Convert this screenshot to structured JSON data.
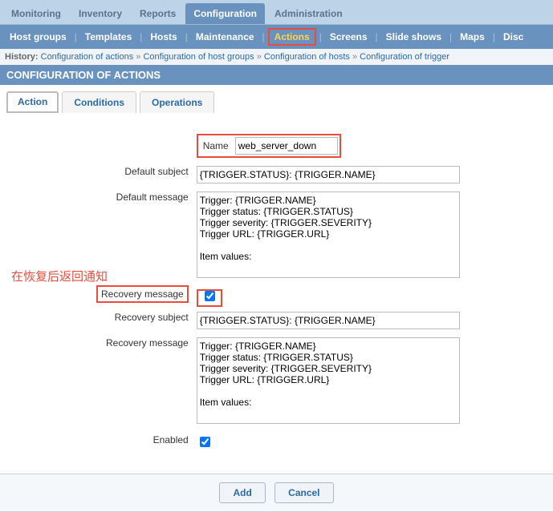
{
  "topnav": {
    "items": [
      {
        "label": "Monitoring"
      },
      {
        "label": "Inventory"
      },
      {
        "label": "Reports"
      },
      {
        "label": "Configuration"
      },
      {
        "label": "Administration"
      }
    ],
    "active_index": 3
  },
  "subnav": {
    "items": [
      {
        "label": "Host groups",
        "hilite": false
      },
      {
        "label": "Templates",
        "hilite": false
      },
      {
        "label": "Hosts",
        "hilite": false
      },
      {
        "label": "Maintenance",
        "hilite": false
      },
      {
        "label": "Actions",
        "hilite": true
      },
      {
        "label": "Screens",
        "hilite": false
      },
      {
        "label": "Slide shows",
        "hilite": false
      },
      {
        "label": "Maps",
        "hilite": false
      },
      {
        "label": "Disc",
        "hilite": false
      }
    ]
  },
  "history": {
    "prefix": "History:",
    "crumbs": [
      "Configuration of actions",
      "Configuration of host groups",
      "Configuration of hosts",
      "Configuration of trigger"
    ]
  },
  "header": "CONFIGURATION OF ACTIONS",
  "tabs": {
    "items": [
      {
        "label": "Action",
        "active": true
      },
      {
        "label": "Conditions",
        "active": false
      },
      {
        "label": "Operations",
        "active": false
      }
    ]
  },
  "form": {
    "name_label": "Name",
    "name_value": "web_server_down",
    "default_subject_label": "Default subject",
    "default_subject_value": "{TRIGGER.STATUS}: {TRIGGER.NAME}",
    "default_message_label": "Default message",
    "default_message_value": "Trigger: {TRIGGER.NAME}\nTrigger status: {TRIGGER.STATUS}\nTrigger severity: {TRIGGER.SEVERITY}\nTrigger URL: {TRIGGER.URL}\n\nItem values:\n",
    "recovery_annotation": "在恢复后返回通知",
    "recovery_message_label": "Recovery message",
    "recovery_message_checked": true,
    "recovery_subject_label": "Recovery subject",
    "recovery_subject_value": "{TRIGGER.STATUS}: {TRIGGER.NAME}",
    "recovery_body_label": "Recovery message",
    "recovery_body_value": "Trigger: {TRIGGER.NAME}\nTrigger status: {TRIGGER.STATUS}\nTrigger severity: {TRIGGER.SEVERITY}\nTrigger URL: {TRIGGER.URL}\n\nItem values:\n",
    "enabled_label": "Enabled",
    "enabled_checked": true
  },
  "footer": {
    "add": "Add",
    "cancel": "Cancel"
  }
}
